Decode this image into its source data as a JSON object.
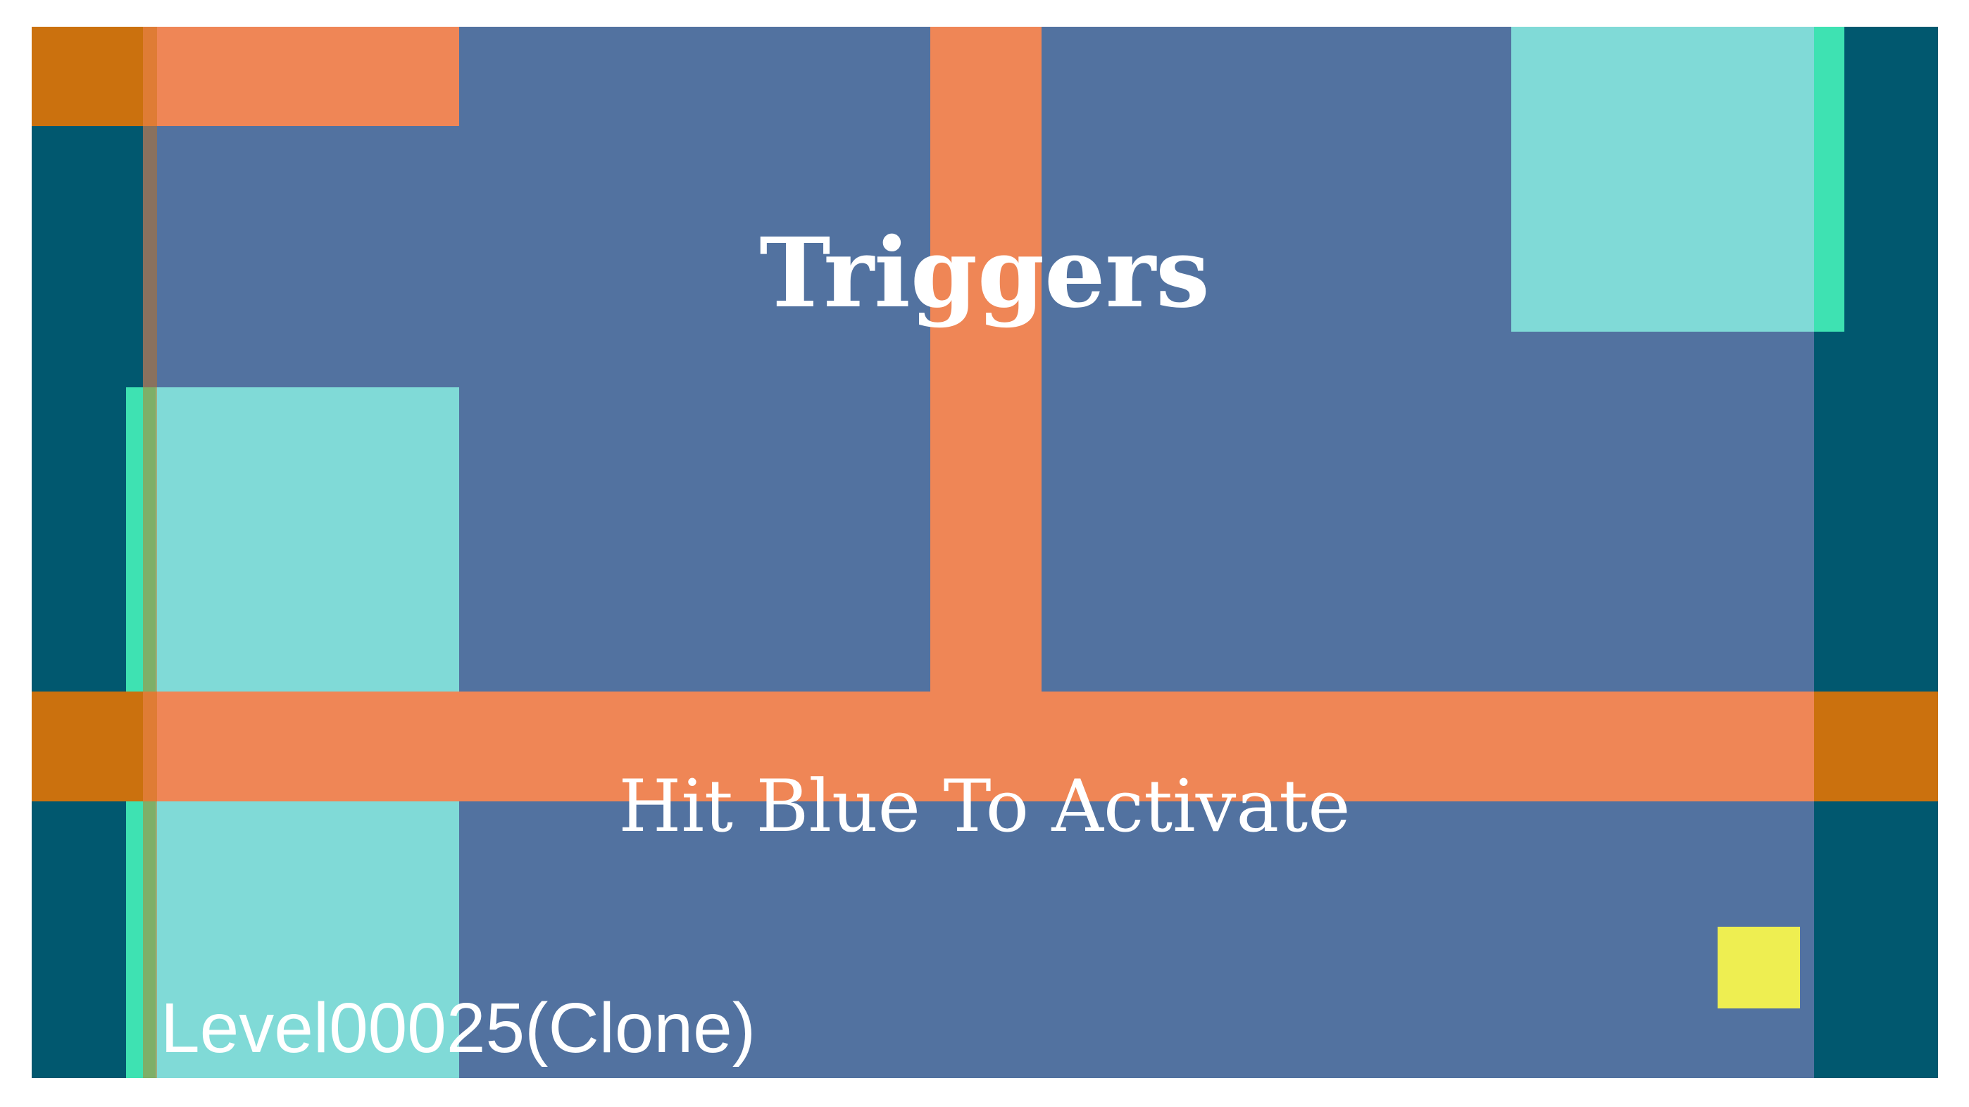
{
  "game": {
    "title": "Triggers",
    "subtitle": "Hit Blue To Activate",
    "level_name": "Level00025(Clone)"
  },
  "colors": {
    "background": "#5272a0",
    "wall_dark_teal": "#01586f",
    "wall_orange": "#ef8656",
    "corner_orange": "#cb710e",
    "trigger_pad": "#80dad7",
    "trigger_edge": "#3ee2b2",
    "player_yellow": "#eeee51",
    "text": "#ffffff"
  }
}
